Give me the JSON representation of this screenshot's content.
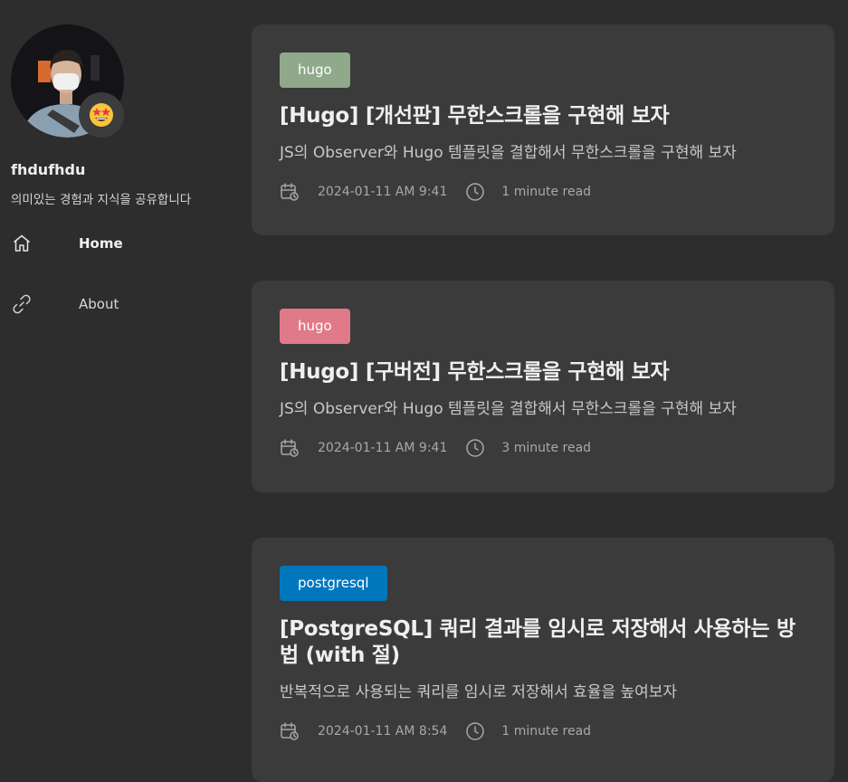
{
  "profile": {
    "name": "fhdufhdu",
    "description": "의미있는 경험과 지식을 공유합니다",
    "emoji_icon": "star-struck-emoji"
  },
  "nav": [
    {
      "label": "Home",
      "icon": "home-icon",
      "active": true
    },
    {
      "label": "About",
      "icon": "link-icon",
      "active": false
    }
  ],
  "posts": [
    {
      "tag": "hugo",
      "tag_color": "#8fa98a",
      "title": "[Hugo] [개선판] 무한스크롤을 구현해 보자",
      "description": "JS의 Observer와 Hugo 템플릿을 결합해서 무한스크롤을 구현해 보자",
      "date": "2024-01-11 AM 9:41",
      "read_time": "1 minute read"
    },
    {
      "tag": "hugo",
      "tag_color": "#e07a88",
      "title": "[Hugo] [구버전] 무한스크롤을 구현해 보자",
      "description": "JS의 Observer와 Hugo 템플릿을 결합해서 무한스크롤을 구현해 보자",
      "date": "2024-01-11 AM 9:41",
      "read_time": "3 minute read"
    },
    {
      "tag": "postgresql",
      "tag_color": "#0077bd",
      "title": "[PostgreSQL] 쿼리 결과를 임시로 저장해서 사용하는 방법 (with 절)",
      "description": "반복적으로 사용되는 쿼리를 임시로 저장해서 효율을 높여보자",
      "date": "2024-01-11 AM 8:54",
      "read_time": "1 minute read"
    }
  ]
}
